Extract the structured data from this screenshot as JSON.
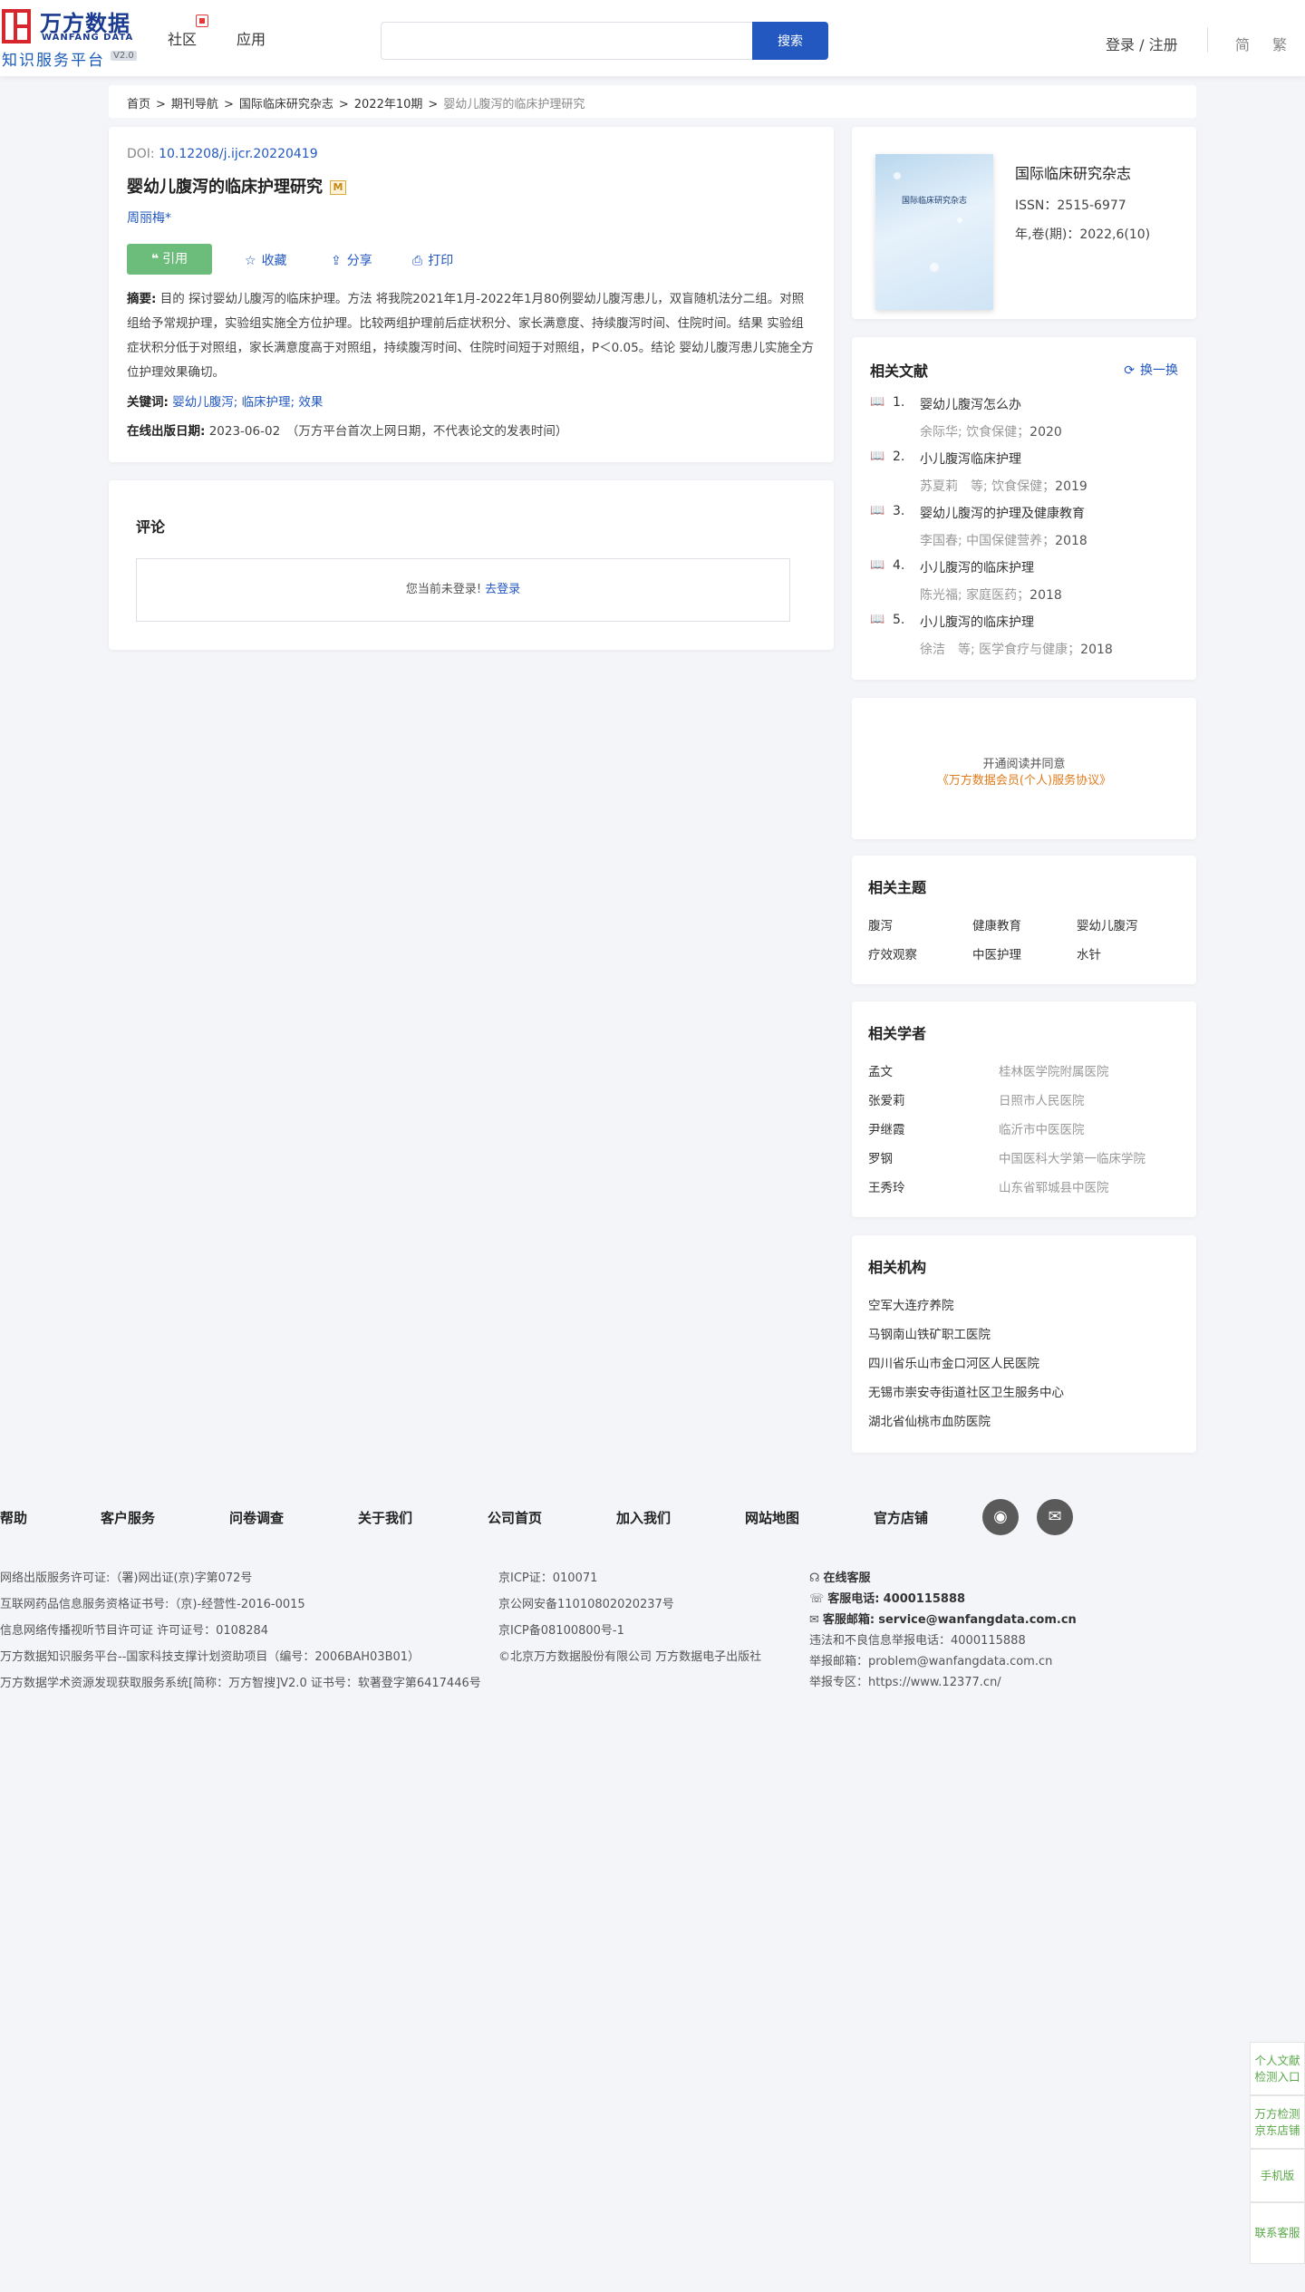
{
  "header": {
    "logo_cn": "万方数据",
    "logo_en": "WANFANG DATA",
    "logo_sub": "知识服务平台",
    "logo_version": "V2.0",
    "nav": [
      "社区",
      "应用"
    ],
    "search_placeholder": "",
    "search_button": "搜索",
    "login": "登录 / 注册",
    "lang_simplified": "简",
    "lang_traditional": "繁"
  },
  "breadcrumb": {
    "items": [
      "首页",
      "期刊导航",
      "国际临床研究杂志",
      "2022年10期"
    ],
    "current": "婴幼儿腹泻的临床护理研究"
  },
  "article": {
    "doi_label": "DOI: ",
    "doi": "10.12208/j.ijcr.20220419",
    "title": "婴幼儿腹泻的临床护理研究",
    "m_badge": "M",
    "author": "周丽梅*",
    "cite_label": "引用",
    "favorite_label": "收藏",
    "share_label": "分享",
    "print_label": "打印",
    "abstract_label": "摘要:",
    "abstract": "目的 探讨婴幼儿腹泻的临床护理。方法 将我院2021年1月-2022年1月80例婴幼儿腹泻患儿，双盲随机法分二组。对照组给予常规护理，实验组实施全方位护理。比较两组护理前后症状积分、家长满意度、持续腹泻时间、住院时间。结果 实验组症状积分低于对照组，家长满意度高于对照组，持续腹泻时间、住院时间短于对照组，P＜0.05。结论 婴幼儿腹泻患儿实施全方位护理效果确切。",
    "keywords_label": "关键词:",
    "keywords": [
      "婴幼儿腹泻;",
      "临床护理;",
      "效果"
    ],
    "pubdate_label": "在线出版日期:",
    "pubdate": "2023-06-02",
    "pubdate_note": "（万方平台首次上网日期，不代表论文的发表时间）"
  },
  "comments": {
    "title": "评论",
    "not_logged_in": "您当前未登录!",
    "login_link": "去登录"
  },
  "journal": {
    "cover_title": "国际临床研究杂志",
    "name": "国际临床研究杂志",
    "issn": "ISSN：2515-6977",
    "volume": "年,卷(期)：2022,6(10)"
  },
  "related_docs": {
    "title": "相关文献",
    "refresh": "换一换",
    "items": [
      {
        "num": "1.",
        "title": "婴幼儿腹泻怎么办",
        "author": "余际华;",
        "source": " 饮食保健；",
        "year": "2020"
      },
      {
        "num": "2.",
        "title": "小儿腹泻临床护理",
        "author": "苏夏莉　等;",
        "source": " 饮食保健；",
        "year": "2019"
      },
      {
        "num": "3.",
        "title": "婴幼儿腹泻的护理及健康教育",
        "author": "李国春;",
        "source": " 中国保健营养；",
        "year": "2018"
      },
      {
        "num": "4.",
        "title": "小儿腹泻的临床护理",
        "author": "陈光福;",
        "source": " 家庭医药；",
        "year": "2018"
      },
      {
        "num": "5.",
        "title": "小儿腹泻的临床护理",
        "author": "徐洁　等;",
        "source": " 医学食疗与健康；",
        "year": "2018"
      }
    ]
  },
  "vip": {
    "line1": "开通阅读并同意",
    "line2": "《万方数据会员(个人)服务协议》"
  },
  "topics": {
    "title": "相关主题",
    "items": [
      "腹泻",
      "健康教育",
      "婴幼儿腹泻",
      "疗效观察",
      "中医护理",
      "水针"
    ]
  },
  "scholars": {
    "title": "相关学者",
    "items": [
      {
        "name": "孟文",
        "org": "桂林医学院附属医院"
      },
      {
        "name": "张爱莉",
        "org": "日照市人民医院"
      },
      {
        "name": "尹继霞",
        "org": "临沂市中医医院"
      },
      {
        "name": "罗钢",
        "org": "中国医科大学第一临床学院"
      },
      {
        "name": "王秀玲",
        "org": "山东省郓城县中医院"
      }
    ]
  },
  "institutions": {
    "title": "相关机构",
    "items": [
      "空军大连疗养院",
      "马钢南山铁矿职工医院",
      "四川省乐山市金口河区人民医院",
      "无锡市崇安寺街道社区卫生服务中心",
      "湖北省仙桃市血防医院"
    ]
  },
  "footer": {
    "links": [
      "帮助",
      "客户服务",
      "问卷调查",
      "关于我们",
      "公司首页",
      "加入我们",
      "网站地图",
      "官方店铺"
    ],
    "col1": [
      "网络出版服务许可证:（署)网出证(京)字第072号",
      "互联网药品信息服务资格证书号:（京)-经营性-2016-0015",
      "信息网络传播视听节目许可证 许可证号：0108284",
      "万方数据知识服务平台--国家科技支撑计划资助项目（编号：2006BAH03B01）",
      "万方数据学术资源发现获取服务系统[简称：万方智搜]V2.0 证书号：软著登字第6417446号"
    ],
    "col2": [
      "京ICP证：010071",
      "京公网安备11010802020237号",
      "京ICP备08100800号-1",
      "©北京万方数据股份有限公司 万方数据电子出版社"
    ],
    "online_service": "在线客服",
    "phone_label": "客服电话:",
    "phone": "4000115888",
    "email_label": "客服邮箱:",
    "email": "service@wanfangdata.com.cn",
    "report1": "违法和不良信息举报电话：4000115888",
    "report2": "举报邮箱：problem@wanfangdata.com.cn",
    "report3": "举报专区：https://www.12377.cn/"
  },
  "side_tabs": [
    "个人文献检测入口",
    "万方检测京东店铺",
    "手机版",
    "联系客服"
  ]
}
